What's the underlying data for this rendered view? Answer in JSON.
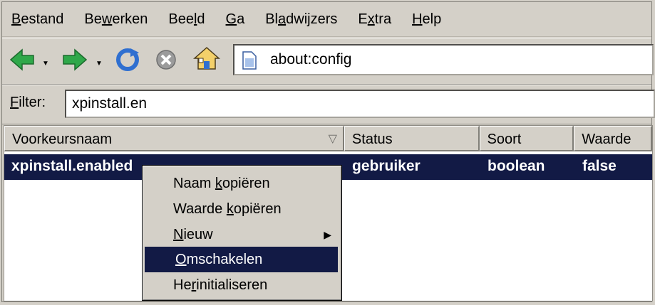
{
  "menubar": {
    "items": [
      {
        "pre": "",
        "u": "B",
        "post": "estand"
      },
      {
        "pre": "Be",
        "u": "w",
        "post": "erken"
      },
      {
        "pre": "Bee",
        "u": "l",
        "post": "d"
      },
      {
        "pre": "",
        "u": "G",
        "post": "a"
      },
      {
        "pre": "Bl",
        "u": "a",
        "post": "dwijzers"
      },
      {
        "pre": "E",
        "u": "x",
        "post": "tra"
      },
      {
        "pre": "",
        "u": "H",
        "post": "elp"
      }
    ]
  },
  "navbar": {
    "url": "about:config",
    "icons": [
      "back-arrow-icon",
      "forward-arrow-icon",
      "reload-icon",
      "stop-icon",
      "home-icon",
      "page-icon"
    ]
  },
  "filter": {
    "label_u": "F",
    "label_rest": "ilter:",
    "value": "xpinstall.en"
  },
  "table": {
    "columns": [
      "Voorkeursnaam",
      "Status",
      "Soort",
      "Waarde"
    ],
    "rows": [
      {
        "name": "xpinstall.enabled",
        "status": "gebruiker",
        "type": "boolean",
        "value": "false"
      }
    ]
  },
  "context_menu": {
    "items": [
      {
        "pre": "Naam ",
        "u": "k",
        "post": "opiëren"
      },
      {
        "pre": "Waarde ",
        "u": "k",
        "post": "opiëren"
      },
      {
        "pre": "",
        "u": "N",
        "post": "ieuw"
      },
      {
        "pre": "",
        "u": "O",
        "post": "mschakelen"
      },
      {
        "pre": "He",
        "u": "r",
        "post": "initialiseren"
      }
    ],
    "selected_index": 3
  },
  "colors": {
    "selection": "#121a45",
    "chrome": "#d4d0c8"
  }
}
